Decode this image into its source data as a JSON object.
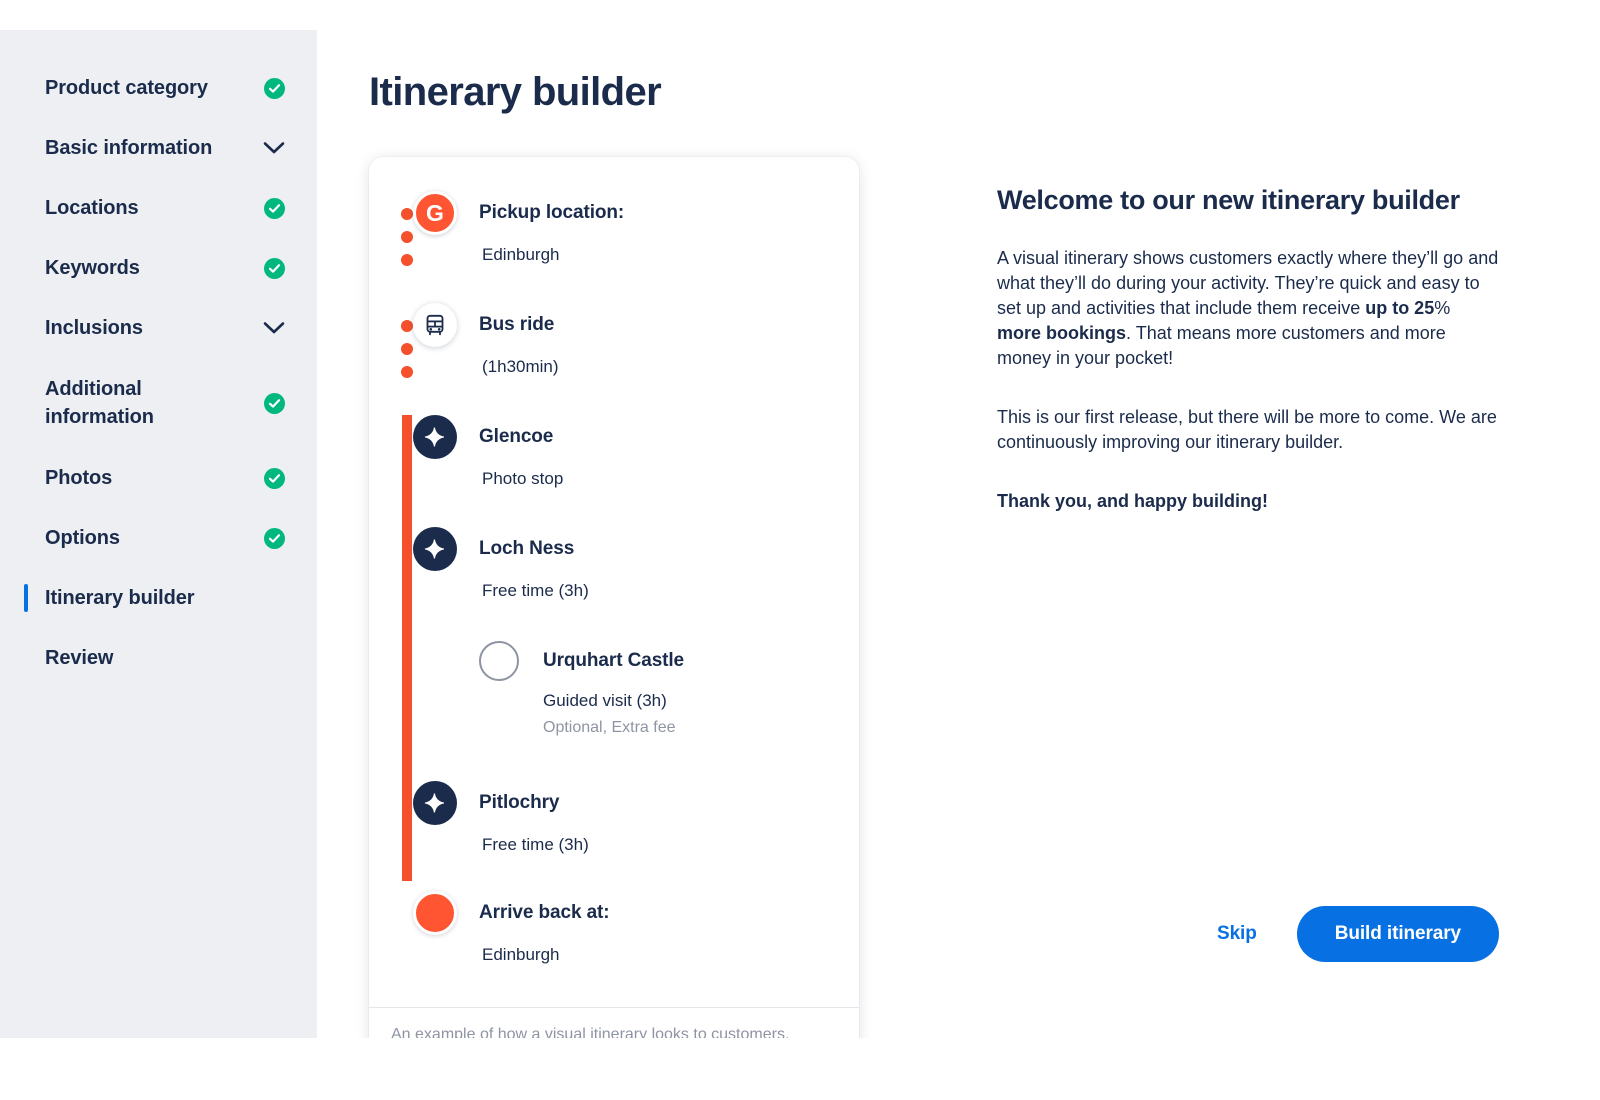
{
  "sidebar": {
    "items": [
      {
        "label": "Product category",
        "status": "check"
      },
      {
        "label": "Basic information",
        "status": "chevron"
      },
      {
        "label": "Locations",
        "status": "check"
      },
      {
        "label": "Keywords",
        "status": "check"
      },
      {
        "label": "Inclusions",
        "status": "chevron"
      },
      {
        "label": "Additional information",
        "status": "check"
      },
      {
        "label": "Photos",
        "status": "check"
      },
      {
        "label": "Options",
        "status": "check"
      },
      {
        "label": "Itinerary builder",
        "status": "none",
        "active": true
      },
      {
        "label": "Review",
        "status": "none"
      }
    ]
  },
  "header": {
    "title": "Itinerary builder"
  },
  "card": {
    "steps": [
      {
        "marker": "gyg-logo-marker",
        "logo": "G",
        "title": "Pickup location:",
        "sub": "Edinburgh",
        "note": "",
        "connector": "dotted"
      },
      {
        "marker": "bus-icon-marker",
        "title": "Bus ride",
        "sub": "(1h30min)",
        "note": "",
        "connector": "dotted"
      },
      {
        "marker": "star-icon-marker",
        "title": "Glencoe",
        "sub": "Photo stop",
        "note": "",
        "connector": "solid"
      },
      {
        "marker": "star-icon-marker",
        "title": "Loch Ness",
        "sub": "Free time (3h)",
        "note": "",
        "connector": "solid"
      },
      {
        "marker": "star-icon-marker",
        "title": "Pitlochry",
        "sub": "Free time (3h)",
        "note": "",
        "connector": "solid"
      },
      {
        "marker": "endpoint-marker",
        "title": "Arrive back at:",
        "sub": "Edinburgh",
        "note": "",
        "connector": "none"
      }
    ],
    "sub_step": {
      "marker": "hollow-circle-marker",
      "title": "Urquhart Castle",
      "sub": "Guided visit (3h)",
      "note": "Optional, Extra fee"
    },
    "caption": "An example of how a visual itinerary looks to customers."
  },
  "panel": {
    "title": "Welcome to our new itinerary builder",
    "paragraph1_a": "A visual itinerary shows customers exactly where they’ll go and what they’ll do during your activity. They’re quick and easy to set up and activities that include them receive ",
    "paragraph1_bold1": "up to 25",
    "paragraph1_mid": "%",
    "paragraph1_bold2": " more bookings",
    "paragraph1_b": ". That means more customers and more money in your pocket!",
    "paragraph2": "This is our first release, but there will be more to come. We are continuously improving our itinerary builder.",
    "paragraph3": "Thank you, and happy building!"
  },
  "actions": {
    "skip_label": "Skip",
    "build_label": "Build itinerary"
  },
  "colors": {
    "accent_blue": "#0770e3",
    "orange": "#ff5533",
    "timeline_orange": "#f4502b",
    "navy": "#1b2b4b",
    "green": "#00b87d",
    "sidebar_bg": "#edeff2",
    "muted": "#8e94a3"
  }
}
